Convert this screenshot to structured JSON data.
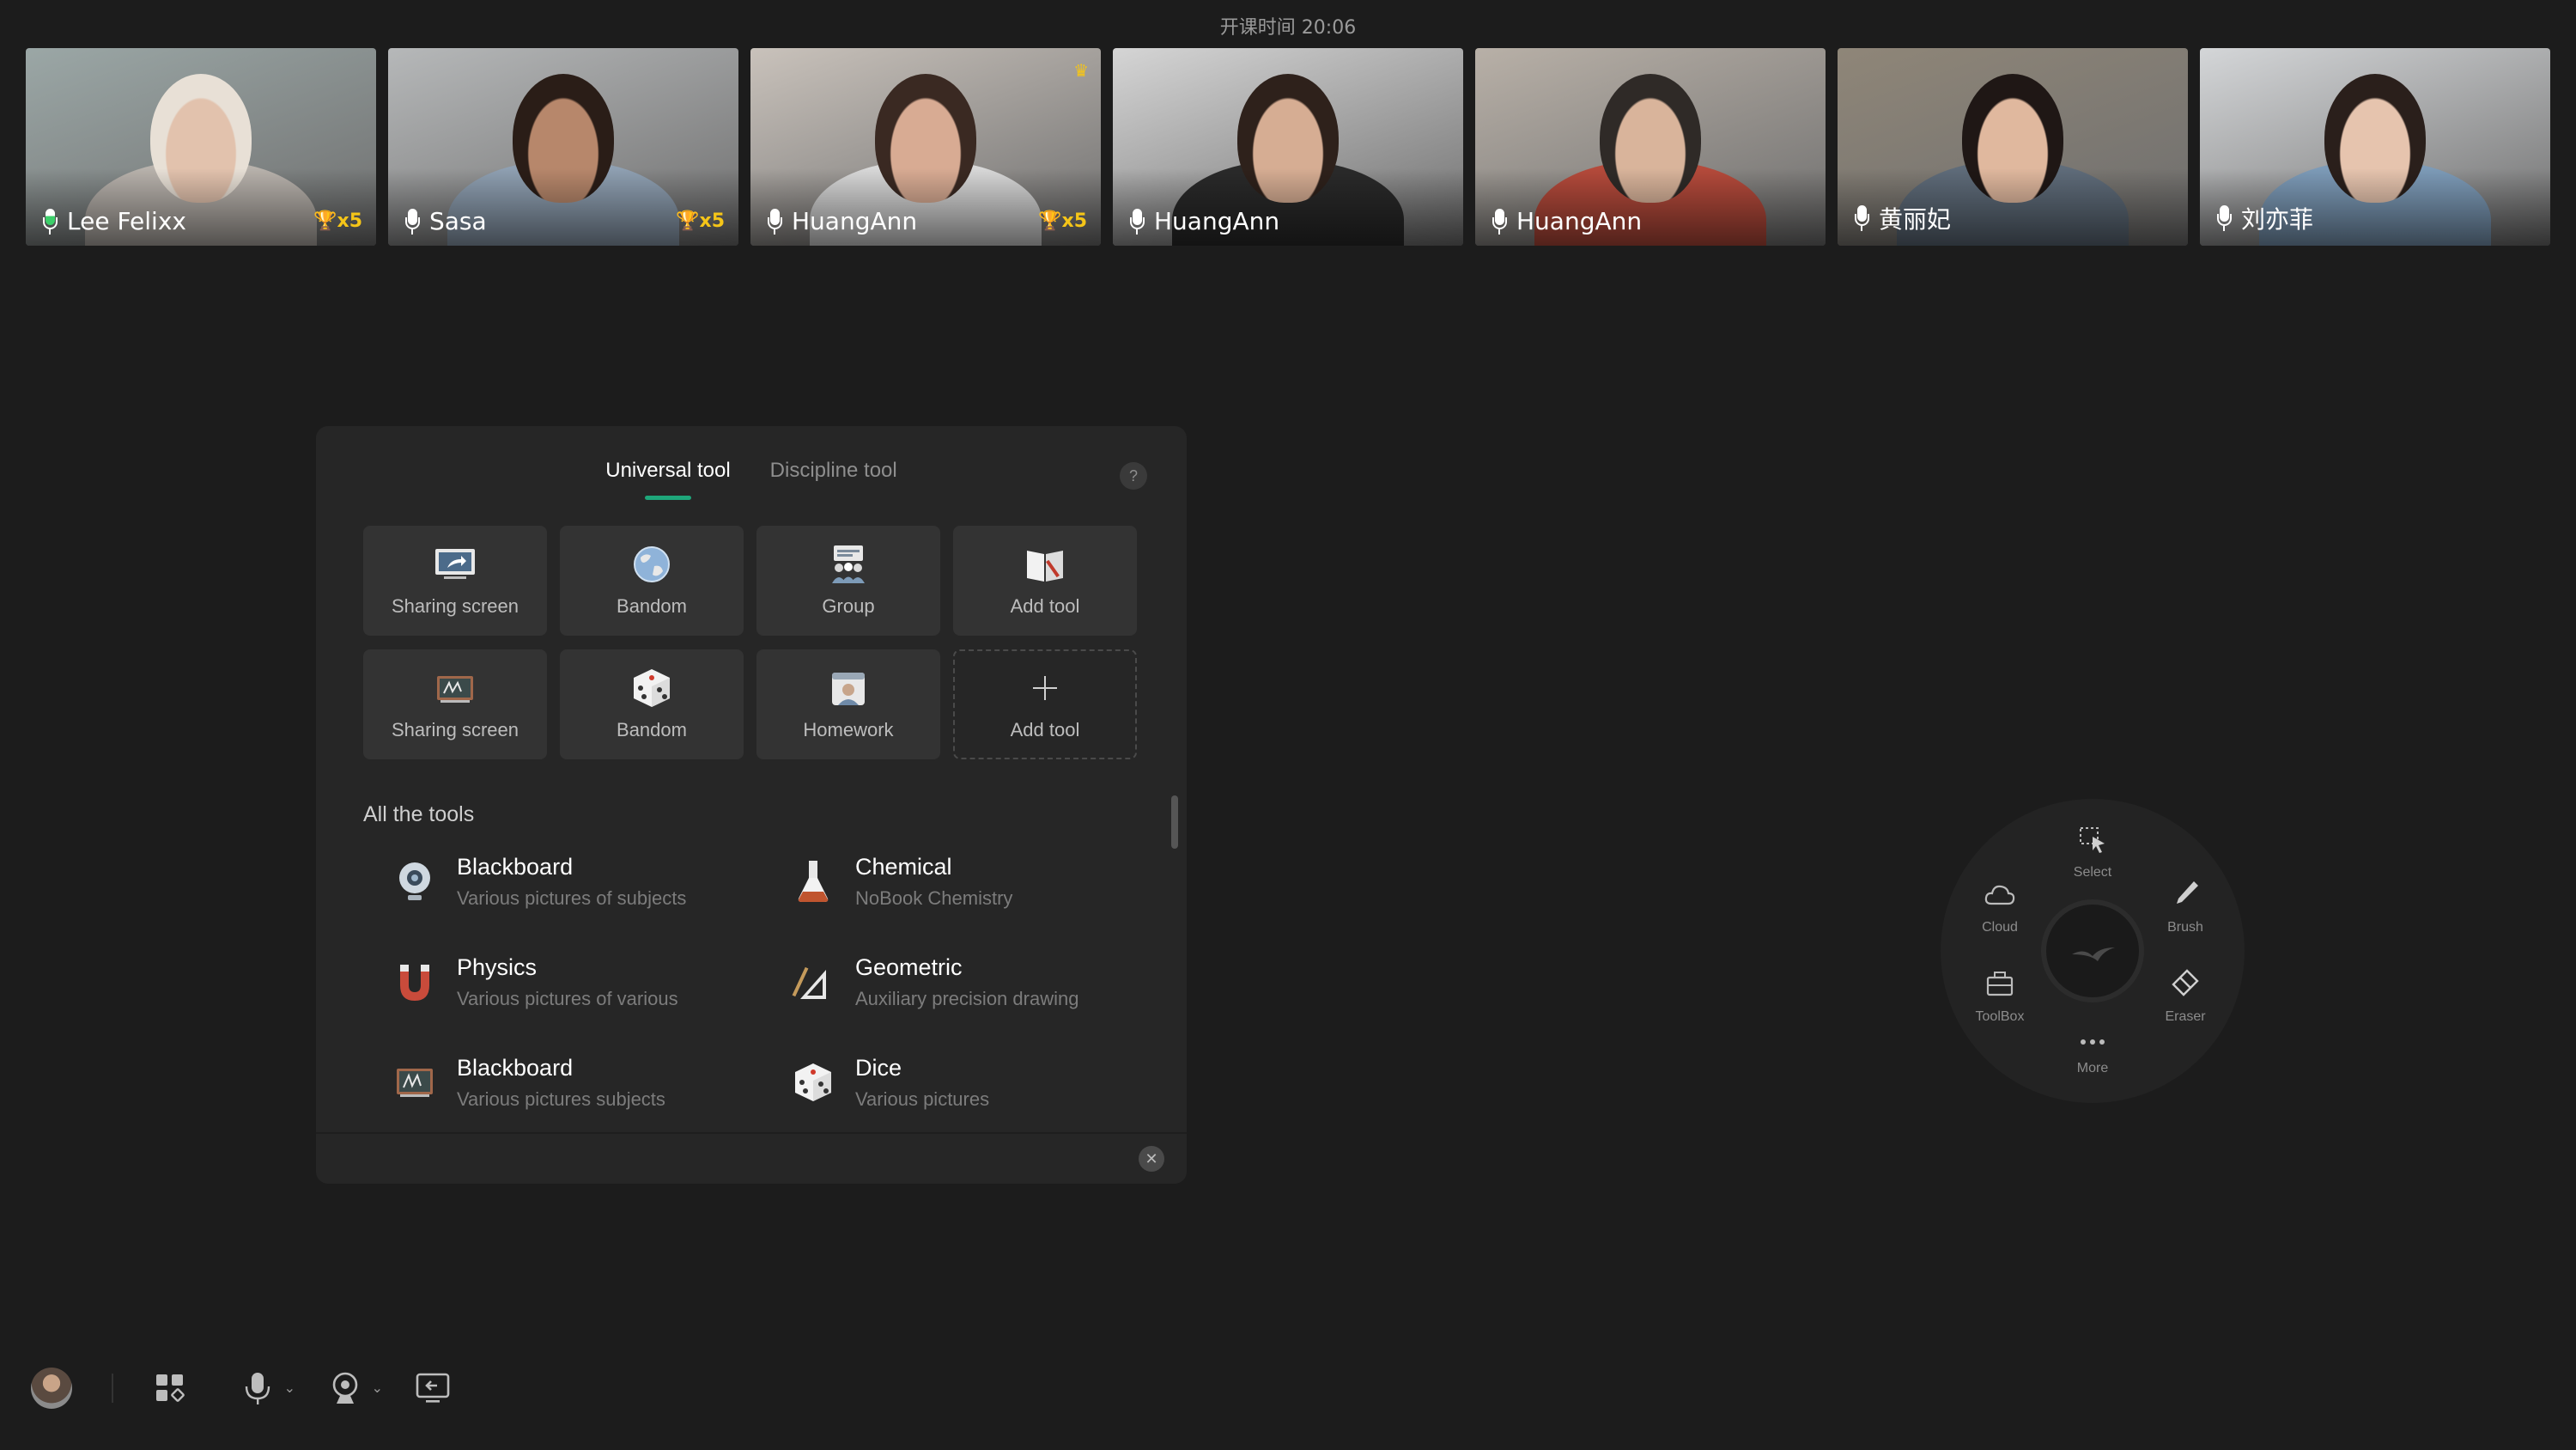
{
  "header": {
    "session_time": "开课时间 20:06"
  },
  "participants": [
    {
      "name": "Lee Felixx",
      "badge": "🏆x5",
      "mic_active": true,
      "bg": "#9ba7a6",
      "skin": "#e2c2ad",
      "hair": "#e8e0d6",
      "shirt": "#b8b2ac"
    },
    {
      "name": "Sasa",
      "badge": "🏆x5",
      "mic_active": false,
      "bg": "#b6b8b9",
      "skin": "#b7876b",
      "hair": "#2a1d17",
      "shirt": "#8fa0b2"
    },
    {
      "name": "HuangAnn",
      "badge": "🏆x5",
      "crown": "♛",
      "mic_active": false,
      "bg": "#c9c2bb",
      "skin": "#d8ab93",
      "hair": "#3a2922",
      "shirt": "#d8d8d8"
    },
    {
      "name": "HuangAnn",
      "badge": "",
      "mic_active": false,
      "bg": "#d5d5d5",
      "skin": "#d6ad93",
      "hair": "#2e211b",
      "shirt": "#2a2a2a"
    },
    {
      "name": "HuangAnn",
      "badge": "",
      "mic_active": false,
      "bg": "#b8b0a7",
      "skin": "#d9b49b",
      "hair": "#2f2a27",
      "shirt": "#b54a3b"
    },
    {
      "name": "黄丽妃",
      "badge": "",
      "mic_active": false,
      "bg": "#8f8678",
      "skin": "#e0b89e",
      "hair": "#1f1715",
      "shirt": "#5f6c7a"
    },
    {
      "name": "刘亦菲",
      "badge": "",
      "mic_active": false,
      "bg": "#d4d6d8",
      "skin": "#e6c4ae",
      "hair": "#2a1f1b",
      "shirt": "#7d9bb8"
    }
  ],
  "panel": {
    "tabs": [
      {
        "label": "Universal tool"
      },
      {
        "label": "Discipline tool"
      }
    ],
    "help": "?",
    "cards": [
      {
        "label": "Sharing screen",
        "icon": "share-screen-icon"
      },
      {
        "label": "Bandom",
        "icon": "globe-icon"
      },
      {
        "label": "Group",
        "icon": "group-icon"
      },
      {
        "label": "Add tool",
        "icon": "book-icon"
      },
      {
        "label": "Sharing screen",
        "icon": "blackboard-icon"
      },
      {
        "label": "Bandom",
        "icon": "dice-icon"
      },
      {
        "label": "Homework",
        "icon": "homework-icon"
      },
      {
        "label": "Add tool",
        "icon": "plus-icon"
      }
    ],
    "section_title": "All the tools",
    "tools": [
      {
        "title": "Blackboard",
        "subtitle": "Various pictures of subjects",
        "icon": "camera-icon"
      },
      {
        "title": "Chemical",
        "subtitle": "NoBook Chemistry",
        "icon": "flask-icon"
      },
      {
        "title": "Physics",
        "subtitle": "Various pictures of various",
        "icon": "magnet-icon"
      },
      {
        "title": "Geometric",
        "subtitle": "Auxiliary precision drawing",
        "icon": "geometry-icon"
      },
      {
        "title": "Blackboard",
        "subtitle": "Various pictures  subjects",
        "icon": "blackboard-icon"
      },
      {
        "title": "Dice",
        "subtitle": "Various pictures",
        "icon": "dice-icon"
      }
    ],
    "close": "✕"
  },
  "radial": {
    "select": "Select",
    "cloud": "Cloud",
    "brush": "Brush",
    "toolbox": "ToolBox",
    "eraser": "Eraser",
    "more": "More"
  },
  "bottom": {
    "caret": "⌄"
  },
  "colors": {
    "accent": "#1ea67a",
    "background": "#1c1c1c",
    "panel": "#262626",
    "badge": "#f5c518"
  }
}
